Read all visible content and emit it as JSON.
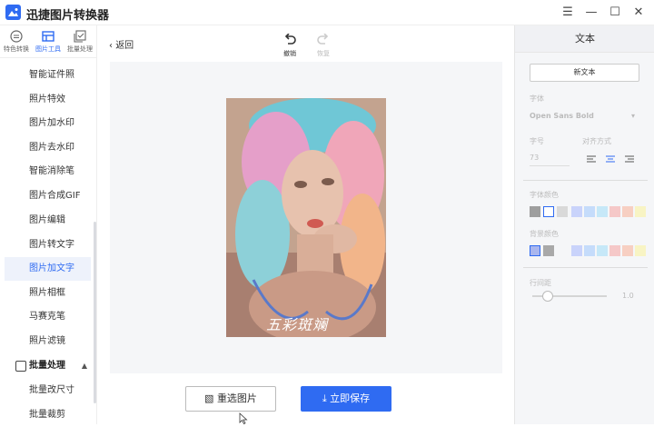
{
  "app": {
    "title": "迅捷图片转换器",
    "accent": "#2f6bf2"
  },
  "window": {
    "menu_icon": "menu-icon",
    "minimize_icon": "minimize-icon",
    "maximize_icon": "maximize-icon",
    "close_icon": "close-icon"
  },
  "nav_tabs": [
    {
      "label": "特色转换",
      "icon": "convert-icon"
    },
    {
      "label": "图片工具",
      "icon": "image-tool-icon"
    },
    {
      "label": "批量处理",
      "icon": "batch-icon"
    }
  ],
  "sidebar": {
    "items": [
      {
        "label": "智能证件照"
      },
      {
        "label": "照片特效"
      },
      {
        "label": "图片加水印"
      },
      {
        "label": "图片去水印"
      },
      {
        "label": "智能消除笔"
      },
      {
        "label": "图片合成GIF"
      },
      {
        "label": "图片编辑"
      },
      {
        "label": "图片转文字"
      },
      {
        "label": "图片加文字",
        "active": true
      },
      {
        "label": "照片相框"
      },
      {
        "label": "马赛克笔"
      },
      {
        "label": "照片滤镜"
      }
    ],
    "section": {
      "label": "批量处理",
      "icon": "batch-icon",
      "caret": "▲"
    },
    "section_items": [
      {
        "label": "批量改尺寸"
      },
      {
        "label": "批量裁剪"
      }
    ]
  },
  "main": {
    "back_label": "返回",
    "undo_label": "撤销",
    "redo_label": "恢复",
    "photo_caption": "五彩斑斓",
    "reselect_label": "重选图片",
    "save_label": "立即保存"
  },
  "panel": {
    "title": "文本",
    "new_text_label": "新文本",
    "font_label": "字体",
    "font_value": "Open Sans Bold",
    "size_label": "字号",
    "size_value": "73",
    "align_label": "对齐方式",
    "font_color_label": "字体颜色",
    "bg_color_label": "背景颜色",
    "line_height_label": "行间距",
    "line_height_value": "1.0",
    "font_colors": [
      "#9e9e9e",
      "#ffffff",
      "#d9d9d9",
      "#c9d3fb",
      "#c5dcfb",
      "#c6e8f8",
      "#f5c8c8",
      "#f7cfc2",
      "#f8f4c4"
    ],
    "bg_colors": [
      "#a9b6ee",
      "#a9a9a9",
      "#f5f6f8",
      "#c9d3fb",
      "#c5dcfb",
      "#c6e8f8",
      "#f5c8c8",
      "#f7cfc2",
      "#f8f4c4"
    ]
  }
}
